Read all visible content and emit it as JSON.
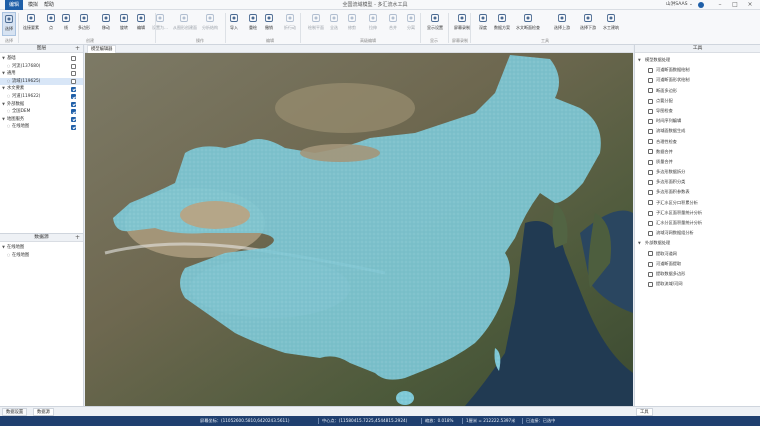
{
  "titlebar": {
    "tabs": [
      "编辑",
      "模拟",
      "帮助"
    ],
    "title": "全国流域模型 - 多汇流水工具",
    "user": "山洪SAAS ⌄"
  },
  "ribbon": {
    "buttons": [
      {
        "label": "选择",
        "icon": "cursor-icon",
        "disabled": false,
        "active": true
      },
      {
        "label": "连接要素",
        "icon": "connect-icon",
        "disabled": false
      },
      {
        "label": "点",
        "icon": "point-icon",
        "disabled": false
      },
      {
        "label": "线",
        "icon": "line-icon",
        "disabled": false
      },
      {
        "label": "多边形",
        "icon": "polygon-icon",
        "disabled": false
      },
      {
        "label": "移动",
        "icon": "move-icon",
        "disabled": false
      },
      {
        "label": "旋转",
        "icon": "rotate-icon",
        "disabled": false
      },
      {
        "label": "编辑",
        "icon": "pencil-icon",
        "disabled": false
      },
      {
        "label": "设置为…",
        "icon": "set-icon",
        "disabled": true
      },
      {
        "label": "从图形创建面",
        "icon": "create-face-icon",
        "disabled": true
      },
      {
        "label": "分析结构",
        "icon": "structure-icon",
        "disabled": true
      },
      {
        "label": "导入",
        "icon": "import-icon",
        "disabled": false
      },
      {
        "label": "重绘",
        "icon": "redraw-icon",
        "disabled": false
      },
      {
        "label": "撤销",
        "icon": "undo-icon",
        "disabled": false
      },
      {
        "label": "折行动",
        "icon": "fold-icon",
        "disabled": true
      },
      {
        "label": "绘制平面",
        "icon": "plane-icon",
        "disabled": true
      },
      {
        "label": "全选",
        "icon": "select-all-icon",
        "disabled": true
      },
      {
        "label": "修剪",
        "icon": "trim-icon",
        "disabled": true
      },
      {
        "label": "拉伸",
        "icon": "stretch-icon",
        "disabled": true
      },
      {
        "label": "合并",
        "icon": "merge-icon",
        "disabled": true
      },
      {
        "label": "分离",
        "icon": "split-icon",
        "disabled": true
      },
      {
        "label": "显示设置",
        "icon": "gear-icon",
        "disabled": false
      },
      {
        "label": "屏幕录制",
        "icon": "record-icon",
        "disabled": false
      },
      {
        "label": "深度",
        "icon": "depth-icon",
        "disabled": false
      },
      {
        "label": "数据方案",
        "icon": "scheme-icon",
        "disabled": false
      },
      {
        "label": "水文断面检查",
        "icon": "check-icon",
        "disabled": false
      },
      {
        "label": "选择上游",
        "icon": "upstream-icon",
        "disabled": false
      },
      {
        "label": "选择下游",
        "icon": "downstream-icon",
        "disabled": false
      },
      {
        "label": "水工建筑",
        "icon": "building-icon",
        "disabled": false
      }
    ],
    "groups": [
      "选择",
      "创建",
      "操作",
      "编辑",
      "高级编辑",
      "显示",
      "屏幕录制",
      "工具"
    ]
  },
  "left_panel": {
    "layers_title": "图层",
    "layers": [
      {
        "label": "基础",
        "level": 0,
        "expanded": true,
        "checked": false
      },
      {
        "label": "河流(137680)",
        "level": 1,
        "checked": false
      },
      {
        "label": "通用",
        "level": 0,
        "expanded": true,
        "checked": false
      },
      {
        "label": "流域(119625)",
        "level": 1,
        "checked": false,
        "selected": true
      },
      {
        "label": "水文要素",
        "level": 0,
        "expanded": true,
        "checked": true
      },
      {
        "label": "河道(119622)",
        "level": 1,
        "checked": true
      },
      {
        "label": "外部数据",
        "level": 0,
        "expanded": true,
        "checked": true
      },
      {
        "label": "全国DEM",
        "level": 1,
        "checked": true
      },
      {
        "label": "地图服务",
        "level": 0,
        "expanded": true,
        "checked": true
      },
      {
        "label": "在线地图",
        "level": 1,
        "checked": true
      }
    ],
    "sources_title": "数据源",
    "sources": [
      {
        "label": "在线地图",
        "level": 0,
        "expanded": true
      },
      {
        "label": "在线地图",
        "level": 1
      }
    ]
  },
  "map": {
    "tab_label": "模型编辑器",
    "colors": {
      "basin": "#7ec8d6",
      "terrain": "#6d6650"
    }
  },
  "right_panel": {
    "title": "工具",
    "tools": [
      {
        "label": "模型数据处理",
        "level": 0,
        "expanded": true
      },
      {
        "label": "河道断面数据绘制",
        "level": 1
      },
      {
        "label": "河道断面形状绘制",
        "level": 1
      },
      {
        "label": "断面多边形",
        "level": 1
      },
      {
        "label": "点要分配",
        "level": 1
      },
      {
        "label": "导图检查",
        "level": 1
      },
      {
        "label": "时间序列编辑",
        "level": 1
      },
      {
        "label": "流域面数据生成",
        "level": 1
      },
      {
        "label": "合理性检查",
        "level": 1
      },
      {
        "label": "数据合并",
        "level": 1
      },
      {
        "label": "质量合并",
        "level": 1
      },
      {
        "label": "多边形数据拆分",
        "level": 1
      },
      {
        "label": "多边形面积分类",
        "level": 1
      },
      {
        "label": "多边形面积参数表",
        "level": 1
      },
      {
        "label": "子汇水区分口积累分析",
        "level": 1
      },
      {
        "label": "子汇水区面积量统计分析",
        "level": 1
      },
      {
        "label": "汇水分区面积量统计分析",
        "level": 1
      },
      {
        "label": "流域河网数据组分析",
        "level": 1
      },
      {
        "label": "外部数据处理",
        "level": 0,
        "expanded": true
      },
      {
        "label": "提取河道网",
        "level": 1
      },
      {
        "label": "河道断面提取",
        "level": 1
      },
      {
        "label": "提取数据多边形",
        "level": 1
      },
      {
        "label": "提取流域/河网",
        "level": 1
      }
    ]
  },
  "bottom_tabs": [
    "数据设置",
    "数据源"
  ],
  "right_bottom_tab": "工具",
  "statusbar": {
    "screen_coord": "屏幕坐标：(11052600.5810,6420243.5611)",
    "center": "中心点：(11580415.7225,4544815.2924)",
    "scale": "缩放：0.018%",
    "ratio": "1厘米 = 212222.5397米",
    "status": "已连接：已选中"
  }
}
